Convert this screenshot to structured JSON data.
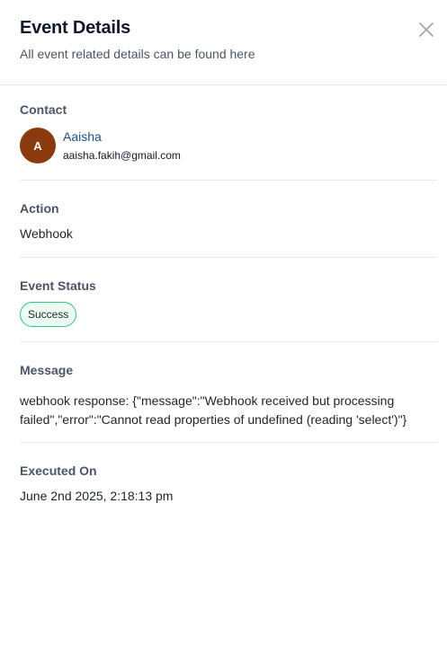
{
  "header": {
    "title": "Event Details",
    "subtitle": "All event related details can be found here"
  },
  "contact": {
    "label": "Contact",
    "avatar_initial": "A",
    "avatar_color": "#8b3a0e",
    "name": "Aaisha",
    "email": "aaisha.fakih@gmail.com"
  },
  "action": {
    "label": "Action",
    "value": "Webhook"
  },
  "event_status": {
    "label": "Event Status",
    "value": "Success",
    "badge_border_color": "#34c77b",
    "badge_bg_color": "#ecfdf3"
  },
  "message": {
    "label": "Message",
    "value": "webhook response: {\"message\":\"Webhook received but processing failed\",\"error\":\"Cannot read properties of undefined (reading 'select')\"}"
  },
  "executed_on": {
    "label": "Executed On",
    "value": "June 2nd 2025, 2:18:13 pm"
  },
  "icons": {
    "close": "close-icon"
  }
}
